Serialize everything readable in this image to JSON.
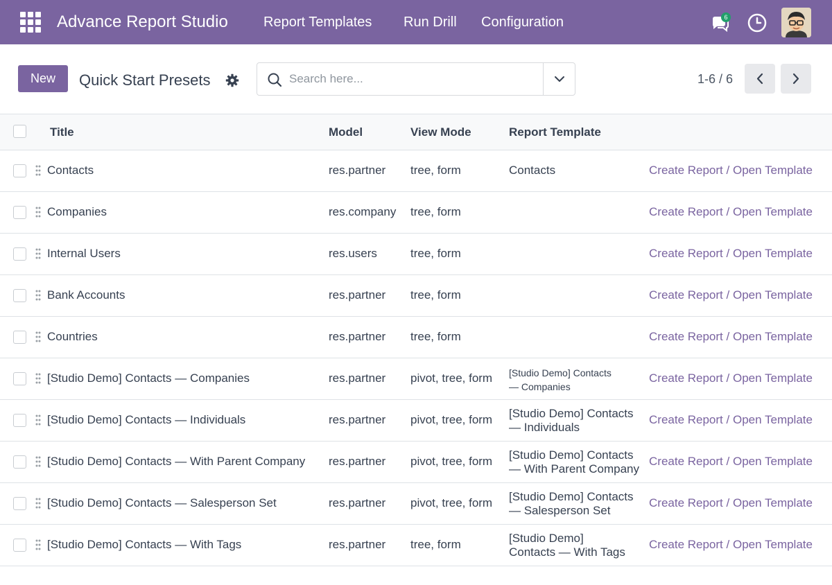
{
  "navbar": {
    "brand": "Advance Report Studio",
    "menu": [
      "Report Templates",
      "Run Drill",
      "Configuration"
    ],
    "message_count": "6",
    "icons": {
      "apps": "grid-apps-icon",
      "messages": "chat-icon",
      "activity": "clock-icon"
    }
  },
  "control_panel": {
    "new_label": "New",
    "title": "Quick Start Presets",
    "search_placeholder": "Search here...",
    "pager": "1-6 / 6"
  },
  "table": {
    "headers": {
      "title": "Title",
      "model": "Model",
      "view_mode": "View Mode",
      "report_template": "Report Template"
    },
    "action_create": "Create Report",
    "action_separator": "/",
    "action_open": "Open Template",
    "rows": [
      {
        "title": "Contacts",
        "model": "res.partner",
        "view_mode": "tree, form",
        "template": "Contacts"
      },
      {
        "title": "Companies",
        "model": "res.company",
        "view_mode": "tree, form",
        "template": ""
      },
      {
        "title": "Internal Users",
        "model": "res.users",
        "view_mode": "tree, form",
        "template": ""
      },
      {
        "title": "Bank Accounts",
        "model": "res.partner",
        "view_mode": "tree, form",
        "template": ""
      },
      {
        "title": "Countries",
        "model": "res.partner",
        "view_mode": "tree, form",
        "template": ""
      },
      {
        "title": "[Studio Demo] Contacts — Companies",
        "model": "res.partner",
        "view_mode": "pivot, tree, form",
        "template_line1": "[Studio Demo] Contacts",
        "template_line2": "— Companies"
      },
      {
        "title": "[Studio Demo] Contacts — Individuals",
        "model": "res.partner",
        "view_mode": "pivot, tree, form",
        "template_line1": "[Studio Demo] Contacts",
        "template_line2": "— Individuals"
      },
      {
        "title": "[Studio Demo] Contacts — With Parent Company",
        "model": "res.partner",
        "view_mode": "pivot, tree, form",
        "template_line1": "[Studio Demo] Contacts",
        "template_line2": "— With Parent Company"
      },
      {
        "title": "[Studio Demo] Contacts — Salesperson Set",
        "model": "res.partner",
        "view_mode": "pivot, tree, form",
        "template_line1": "[Studio Demo] Contacts",
        "template_line2": "— Salesperson Set"
      },
      {
        "title": "[Studio Demo] Contacts — With Tags",
        "model": "res.partner",
        "view_mode": "tree, form",
        "template_line1": "[Studio Demo]",
        "template_line2": "Contacts — With Tags"
      }
    ]
  },
  "colors": {
    "brand": "#7a64a0",
    "badge": "#22a06b",
    "link": "#7a64a0"
  }
}
